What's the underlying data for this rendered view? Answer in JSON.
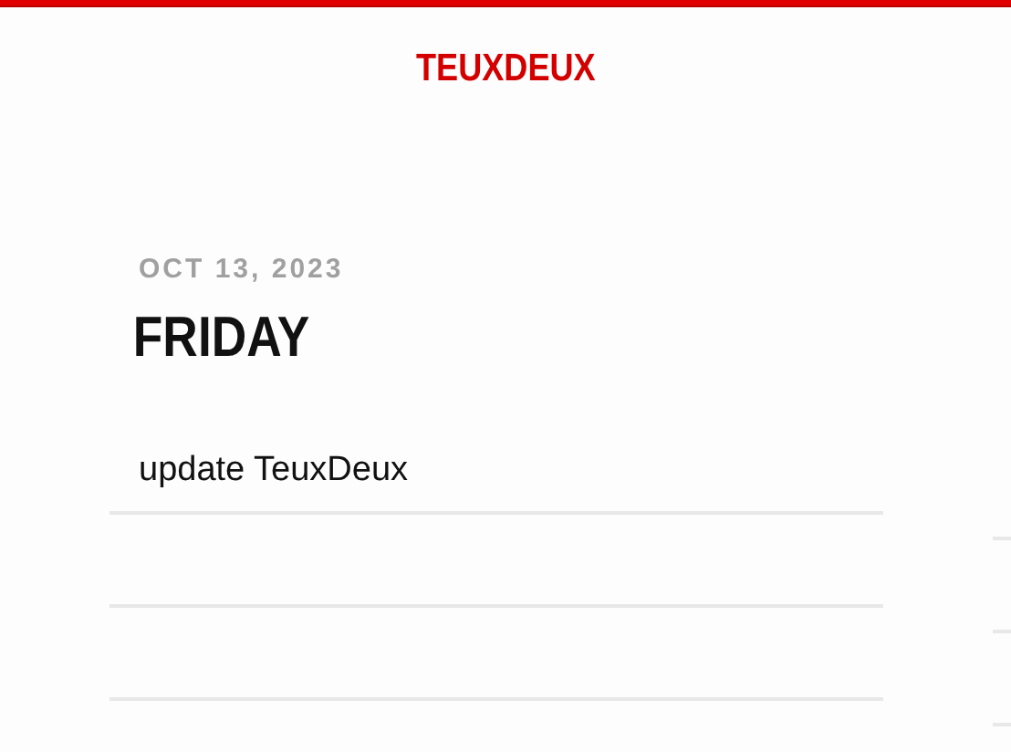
{
  "brand": "TEUXDEUX",
  "day": {
    "date": "OCT 13, 2023",
    "weekday": "FRIDAY",
    "todos": [
      {
        "text": "update TeuxDeux"
      }
    ]
  }
}
